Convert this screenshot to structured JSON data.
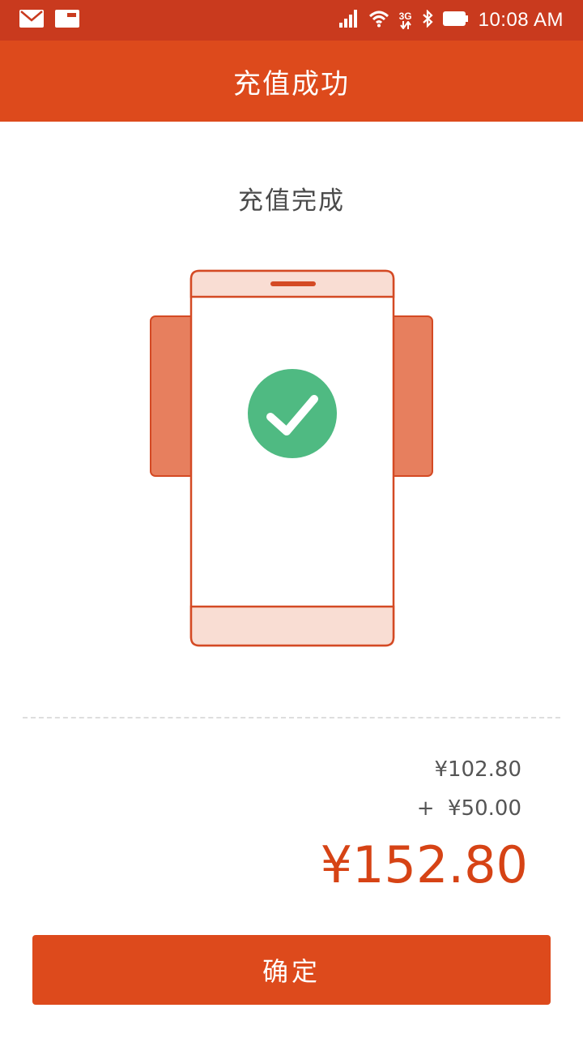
{
  "status_bar": {
    "time": "10:08 AM",
    "network_label": "3G",
    "icons": [
      "mail-icon",
      "message-icon",
      "signal-icon",
      "wifi-icon",
      "network-3g-icon",
      "bluetooth-icon",
      "battery-icon"
    ]
  },
  "header": {
    "title": "充值成功"
  },
  "main": {
    "subtitle": "充值完成",
    "illustration_icon": "phone-success-icon",
    "check_icon": "check-icon"
  },
  "summary": {
    "base_amount": "¥102.80",
    "added_amount": "+  ¥50.00",
    "total_amount": "¥152.80"
  },
  "footer": {
    "confirm_label": "确定"
  },
  "colors": {
    "status_bar": "#C93A1E",
    "accent": "#DD4A1C",
    "total_text": "#D64315",
    "success_green": "#4FBA82",
    "phone_fill_light": "#F9DDD3",
    "side_panel": "#E77F5E"
  }
}
